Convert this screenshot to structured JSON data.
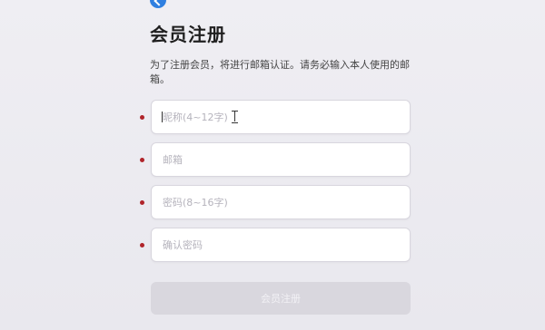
{
  "header": {
    "title": "会员注册",
    "description": "为了注册会员，将进行邮箱认证。请务必输入本人使用的邮箱。"
  },
  "form": {
    "fields": [
      {
        "name": "username",
        "placeholder": "昵称(4~12字)",
        "value": "",
        "required": true,
        "focused": true
      },
      {
        "name": "email",
        "placeholder": "邮箱",
        "value": "",
        "required": true,
        "focused": false
      },
      {
        "name": "password",
        "placeholder": "密码(8~16字)",
        "value": "",
        "required": true,
        "focused": false
      },
      {
        "name": "confirm-password",
        "placeholder": "确认密码",
        "value": "",
        "required": true,
        "focused": false
      }
    ],
    "submit_label": "会员注册",
    "submit_enabled": false
  },
  "colors": {
    "brand": "#2f7fe0",
    "required": "#b0242a",
    "button_disabled": "#d9d7de",
    "background": "#eceaf0"
  },
  "icons": {
    "brand": "brand-badge-icon",
    "pointer": "text-cursor-icon"
  }
}
